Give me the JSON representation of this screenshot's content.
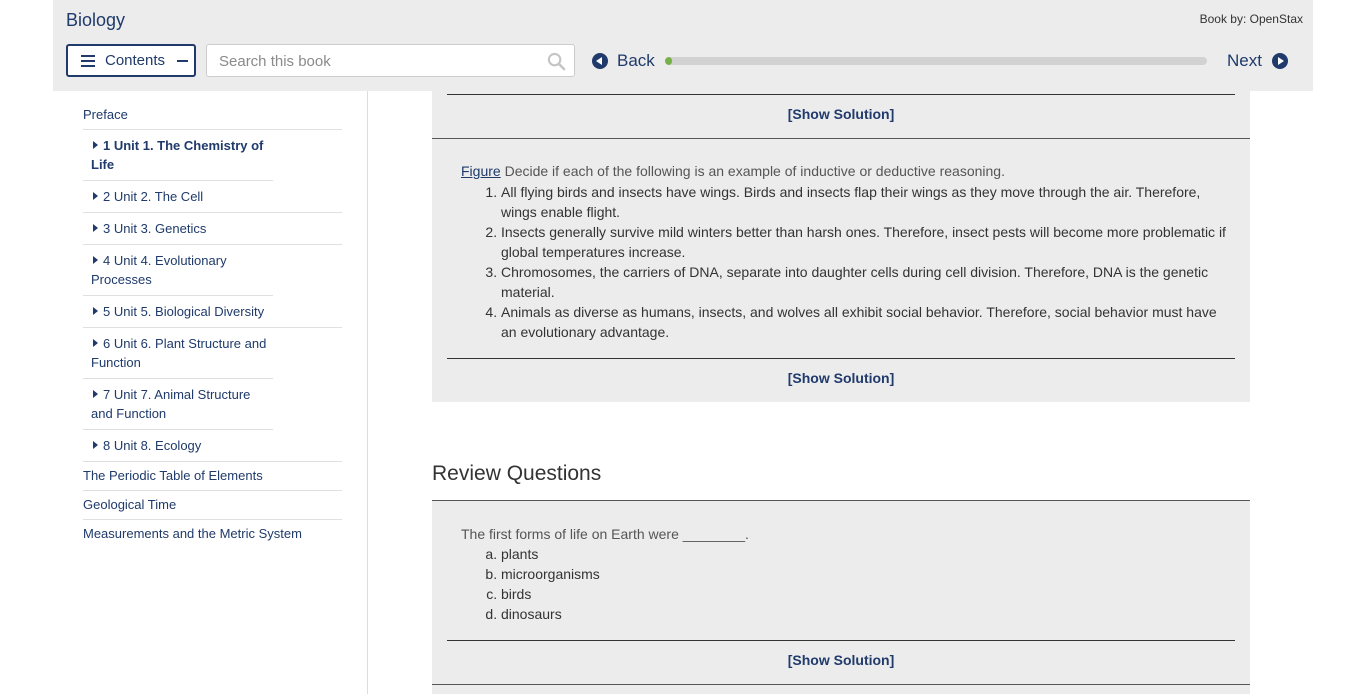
{
  "header": {
    "book_title": "Biology",
    "book_by": "Book by: OpenStax",
    "contents_label": "Contents",
    "search_placeholder": "Search this book",
    "back_label": "Back",
    "next_label": "Next",
    "progress_fraction": 0.01
  },
  "sidebar": {
    "items": [
      {
        "label": "Preface",
        "type": "top"
      },
      {
        "label": "1 Unit 1. The Chemistry of Life",
        "type": "unit",
        "bold": true
      },
      {
        "label": "2 Unit 2. The Cell",
        "type": "unit"
      },
      {
        "label": "3 Unit 3. Genetics",
        "type": "unit"
      },
      {
        "label": "4 Unit 4. Evolutionary Processes",
        "type": "unit"
      },
      {
        "label": "5 Unit 5. Biological Diversity",
        "type": "unit"
      },
      {
        "label": "6 Unit 6. Plant Structure and Function",
        "type": "unit"
      },
      {
        "label": "7 Unit 7. Animal Structure and Function",
        "type": "unit"
      },
      {
        "label": "8 Unit 8. Ecology",
        "type": "unit"
      },
      {
        "label": "The Periodic Table of Elements",
        "type": "top"
      },
      {
        "label": "Geological Time",
        "type": "top"
      },
      {
        "label": "Measurements and the Metric System",
        "type": "top"
      }
    ]
  },
  "main": {
    "show_solution_label": "[Show Solution]",
    "question_2": {
      "figure_link": "Figure",
      "intro": " Decide if each of the following is an example of inductive or deductive reasoning.",
      "items": [
        "All flying birds and insects have wings. Birds and insects flap their wings as they move through the air. Therefore, wings enable flight.",
        "Insects generally survive mild winters better than harsh ones. Therefore, insect pests will become more problematic if global temperatures increase.",
        "Chromosomes, the carriers of DNA, separate into daughter cells during cell division. Therefore, DNA is the genetic material.",
        "Animals as diverse as humans, insects, and wolves all exhibit social behavior. Therefore, social behavior must have an evolutionary advantage."
      ]
    },
    "review_title": "Review Questions",
    "review_q1": {
      "prompt": "The first forms of life on Earth were ________.",
      "options": [
        "plants",
        "microorganisms",
        "birds",
        "dinosaurs"
      ]
    }
  }
}
